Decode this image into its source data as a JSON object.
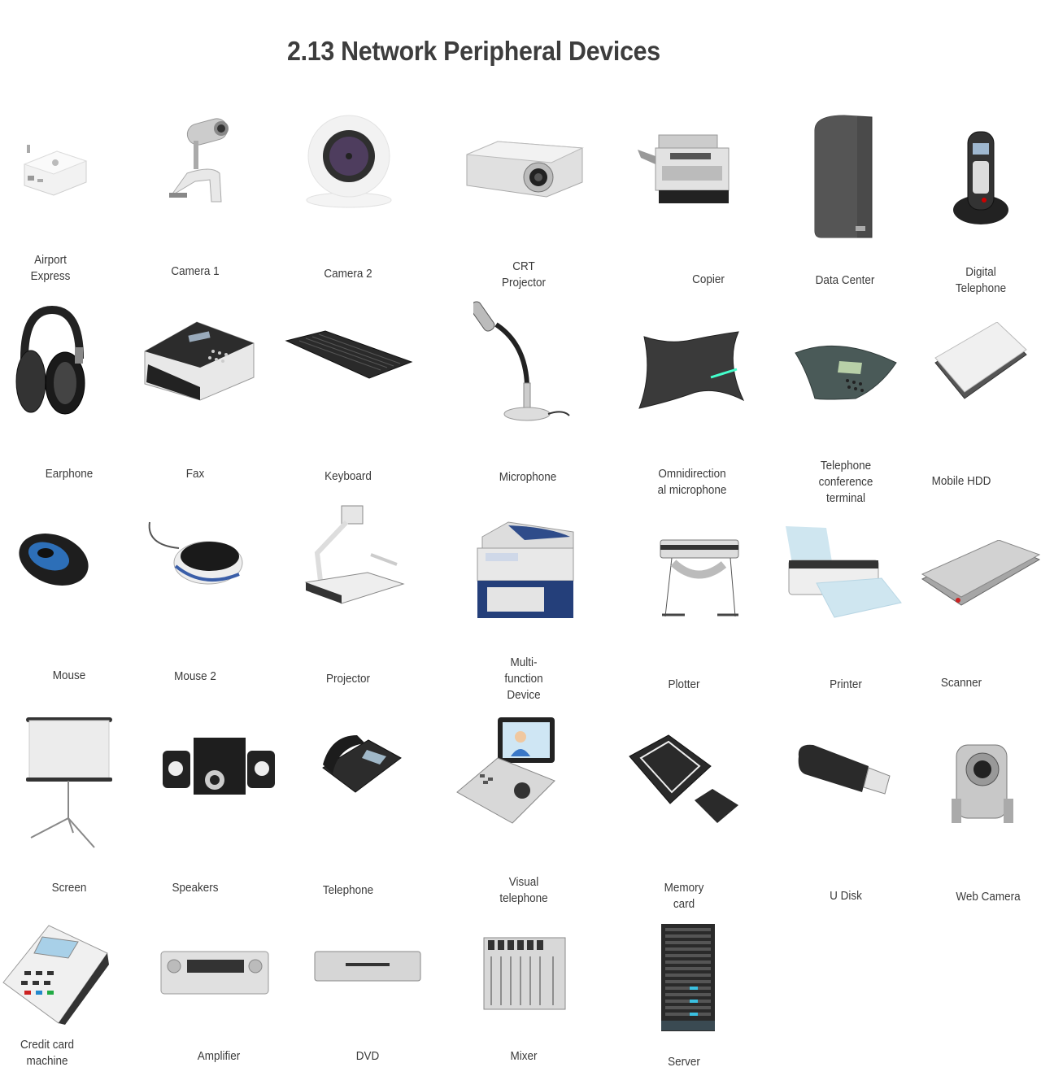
{
  "title": "2.13 Network Peripheral Devices",
  "devices": [
    {
      "label": "Airport\nExpress",
      "icon": "airport-express-icon"
    },
    {
      "label": "Camera 1",
      "icon": "camera-1-icon"
    },
    {
      "label": "Camera 2",
      "icon": "camera-2-icon"
    },
    {
      "label": "CRT\nProjector",
      "icon": "crt-projector-icon"
    },
    {
      "label": "Copier",
      "icon": "copier-icon"
    },
    {
      "label": "Data Center",
      "icon": "data-center-icon"
    },
    {
      "label": "Digital\nTelephone",
      "icon": "digital-telephone-icon"
    },
    {
      "label": "Earphone",
      "icon": "earphone-icon"
    },
    {
      "label": "Fax",
      "icon": "fax-icon"
    },
    {
      "label": "Keyboard",
      "icon": "keyboard-icon"
    },
    {
      "label": "Microphone",
      "icon": "microphone-icon"
    },
    {
      "label": "Omnidirection\nal microphone",
      "icon": "omnidirectional-microphone-icon"
    },
    {
      "label": "Telephone\nconference\nterminal",
      "icon": "conference-phone-icon"
    },
    {
      "label": "Mobile HDD",
      "icon": "mobile-hdd-icon"
    },
    {
      "label": "Mouse",
      "icon": "mouse-icon"
    },
    {
      "label": "Mouse 2",
      "icon": "mouse-2-icon"
    },
    {
      "label": "Projector",
      "icon": "document-projector-icon"
    },
    {
      "label": "Multi-\nfunction\nDevice",
      "icon": "multifunction-device-icon"
    },
    {
      "label": "Plotter",
      "icon": "plotter-icon"
    },
    {
      "label": "Printer",
      "icon": "printer-icon"
    },
    {
      "label": "Scanner",
      "icon": "scanner-icon"
    },
    {
      "label": "Screen",
      "icon": "projection-screen-icon"
    },
    {
      "label": "Speakers",
      "icon": "speakers-icon"
    },
    {
      "label": "Telephone",
      "icon": "telephone-icon"
    },
    {
      "label": "Visual\ntelephone",
      "icon": "visual-telephone-icon"
    },
    {
      "label": "Memory\ncard",
      "icon": "memory-card-icon"
    },
    {
      "label": "U Disk",
      "icon": "usb-disk-icon"
    },
    {
      "label": "Web Camera",
      "icon": "web-camera-icon"
    },
    {
      "label": "Credit card\nmachine",
      "icon": "credit-card-machine-icon"
    },
    {
      "label": "Amplifier",
      "icon": "amplifier-icon"
    },
    {
      "label": "DVD",
      "icon": "dvd-player-icon"
    },
    {
      "label": "Mixer",
      "icon": "mixer-icon"
    },
    {
      "label": "Server",
      "icon": "server-rack-icon"
    }
  ]
}
